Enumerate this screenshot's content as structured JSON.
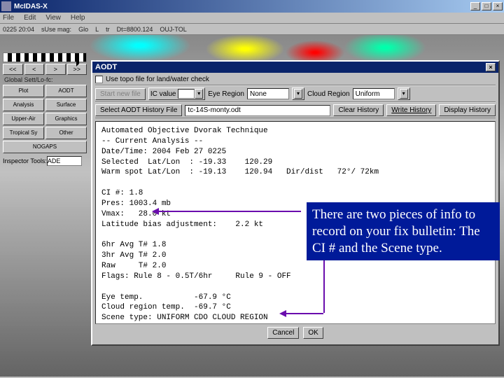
{
  "app": {
    "title": "McIDAS-X",
    "menus": [
      "File",
      "Edit",
      "View",
      "Help"
    ],
    "info": [
      "0225 20:04",
      "sUse mag:",
      "Glo",
      "L",
      "tr",
      "Dt=8800.124",
      "OUJ-TOL"
    ]
  },
  "left": {
    "nav": [
      "<<",
      "<",
      ">",
      ">>"
    ],
    "global_label": "Global Sett/Lo-fc:",
    "buttons": [
      {
        "label": "Plot"
      },
      {
        "label": "AODT"
      },
      {
        "label": "Analysis"
      },
      {
        "label": "Surface"
      },
      {
        "label": "Upper-Air"
      },
      {
        "label": "Graphics"
      },
      {
        "label": "Tropical Sy"
      },
      {
        "label": "Other"
      },
      {
        "label": "NOGAPS",
        "wide": true
      }
    ],
    "inspector_label": "Inspector Tools:",
    "inspector_value": "ADE"
  },
  "dialog": {
    "title": "AODT",
    "topo_label": "Use topo file for land/water check",
    "row2": {
      "start": "Start new file",
      "ic": "IC value",
      "eye_label": "Eye Region",
      "eye_value": "None",
      "cloud_label": "Cloud Region",
      "cloud_value": "Uniform"
    },
    "row3": {
      "select": "Select AODT History File",
      "file": "tc-14S-monty.odt",
      "clear": "Clear History",
      "write": "Write History",
      "display": "Display History"
    },
    "output": "Automated Objective Dvorak Technique\n-- Current Analysis --\nDate/Time: 2004 Feb 27 0225\nSelected  Lat/Lon  : -19.33    120.29\nWarm spot Lat/Lon  : -19.13    120.94   Dir/dist   72°/ 72km\n\nCI #: 1.8\nPres: 1003.4 mb\nVmax:   28.0 kt\nLatitude bias adjustment:    2.2 kt\n\n6hr Avg T# 1.8\n3hr Avg T# 2.0\nRaw     T# 2.0\nFlags: Rule 8 - 0.5T/6hr     Rule 9 - OFF\n\nEye temp.           -67.9 °C\nCloud region temp.  -69.7 °C\nScene type: UNIFORM CDO CLOUD REGION",
    "cancel": "Cancel",
    "ok": "OK"
  },
  "note": "There are two pieces of info to record on your fix bulletin: The CI # and  the Scene type."
}
